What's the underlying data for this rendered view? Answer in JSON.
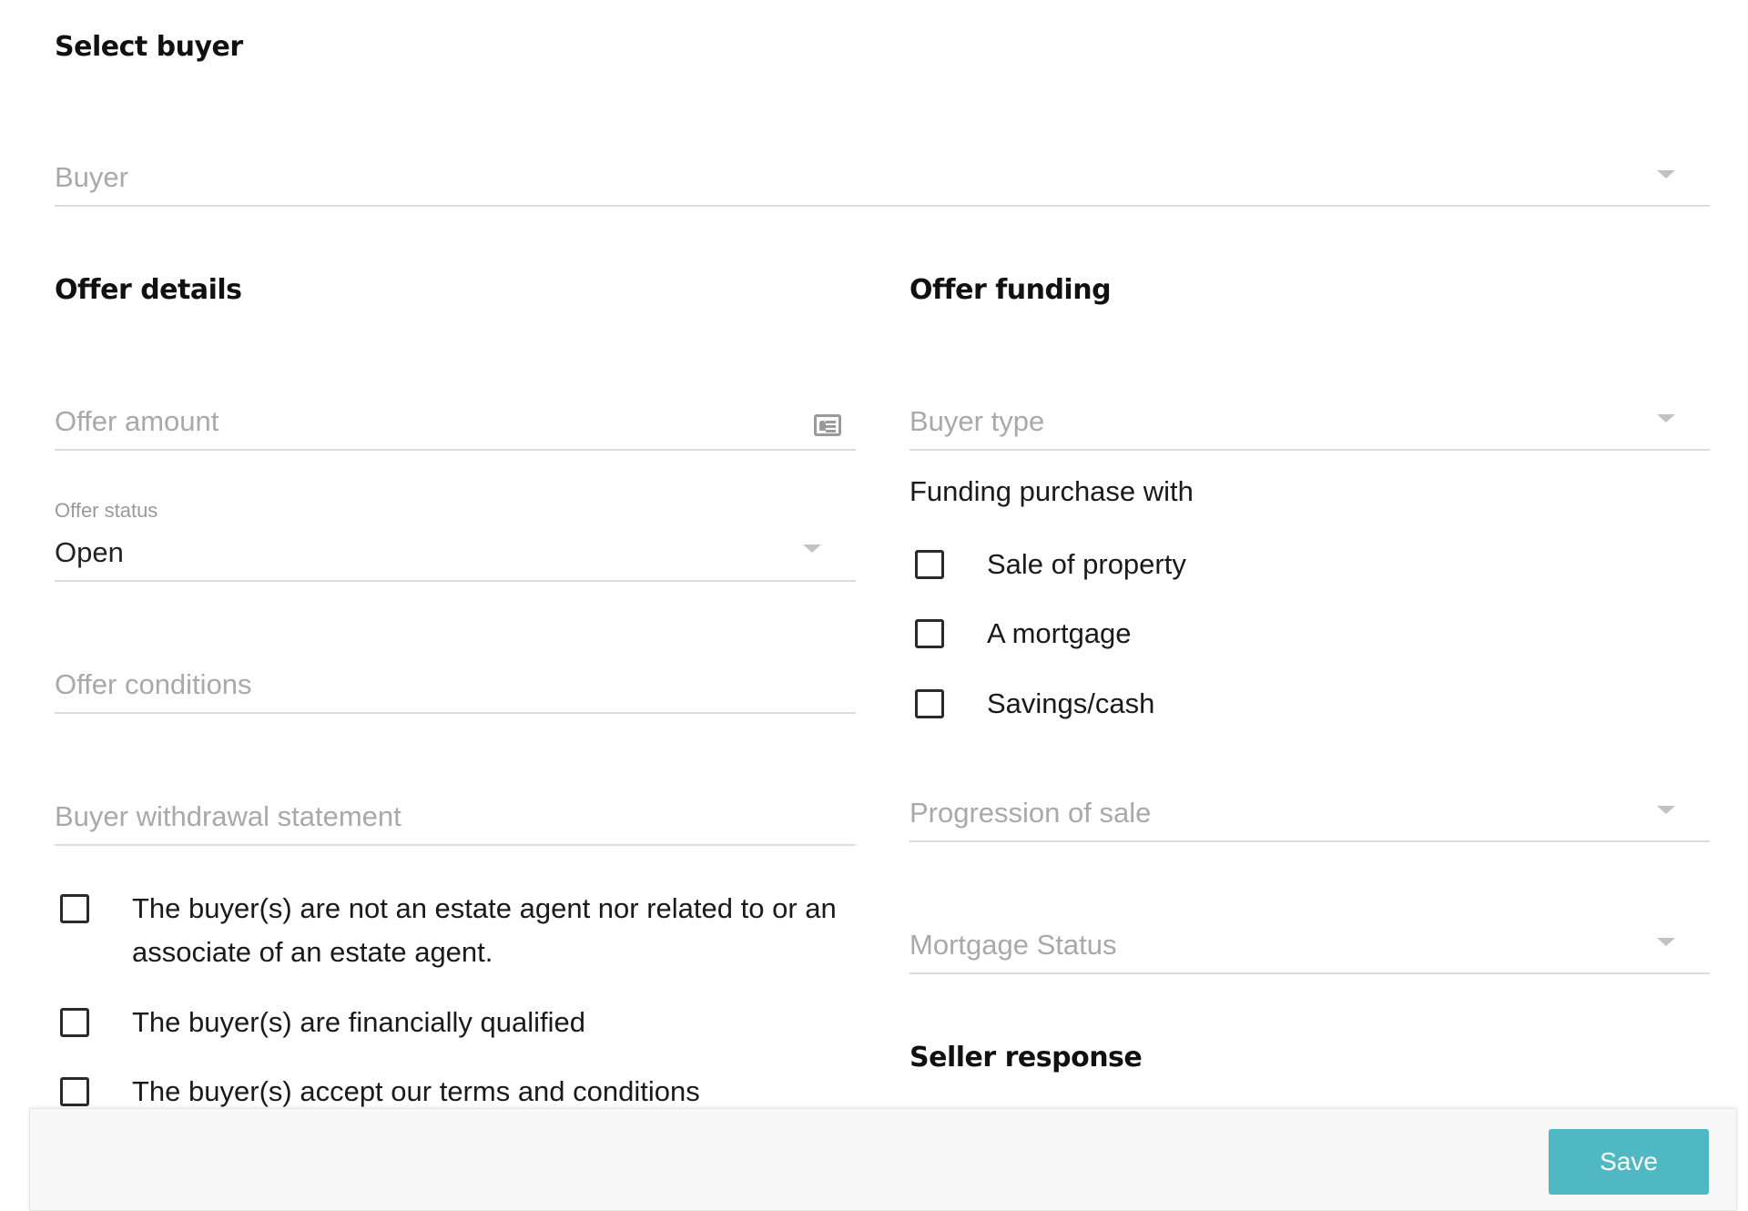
{
  "select_buyer": {
    "heading": "Select buyer",
    "buyer_placeholder": "Buyer"
  },
  "offer_details": {
    "heading": "Offer details",
    "offer_amount_placeholder": "Offer amount",
    "offer_status_label": "Offer status",
    "offer_status_value": "Open",
    "offer_conditions_placeholder": "Offer conditions",
    "withdrawal_statement_placeholder": "Buyer withdrawal statement",
    "checkboxes": [
      {
        "label_line1": "The buyer(s) are not an estate agent nor related to or an",
        "label_line2": "associate of an estate agent.",
        "checked": false
      },
      {
        "label": "The buyer(s) are financially qualified",
        "checked": false
      },
      {
        "label": "The buyer(s) accept our terms and conditions",
        "checked": false
      }
    ]
  },
  "offer_funding": {
    "heading": "Offer funding",
    "buyer_type_placeholder": "Buyer type",
    "funding_label": "Funding purchase with",
    "funding_options": [
      {
        "label": "Sale of property",
        "checked": false
      },
      {
        "label": "A mortgage",
        "checked": false
      },
      {
        "label": "Savings/cash",
        "checked": false
      }
    ],
    "progression_placeholder": "Progression of sale",
    "mortgage_status_placeholder": "Mortgage Status"
  },
  "seller_response": {
    "heading": "Seller response"
  },
  "footer": {
    "save_label": "Save",
    "save_color": "#4fb8c2"
  },
  "icons": {
    "dropdown": "chevron-down-icon",
    "offer_amount": "id-card-icon"
  }
}
